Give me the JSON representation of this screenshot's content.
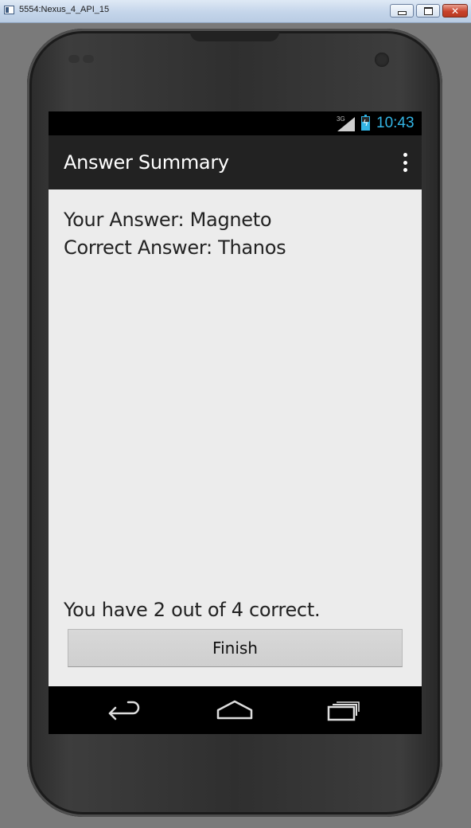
{
  "window": {
    "title": "5554:Nexus_4_API_15",
    "buttons": [
      "minimize",
      "maximize",
      "close"
    ]
  },
  "status_bar": {
    "network": "3G",
    "time": "10:43",
    "accent_color": "#33b5e5"
  },
  "action_bar": {
    "title": "Answer Summary",
    "overflow_icon": "overflow-menu-icon"
  },
  "content": {
    "your_answer": "Your Answer: Magneto",
    "correct_answer": "Correct Answer: Thanos",
    "score_text": "You have 2 out of 4 correct.",
    "finish_label": "Finish"
  },
  "nav_bar": {
    "icons": [
      "back-icon",
      "home-icon",
      "recents-icon"
    ]
  }
}
